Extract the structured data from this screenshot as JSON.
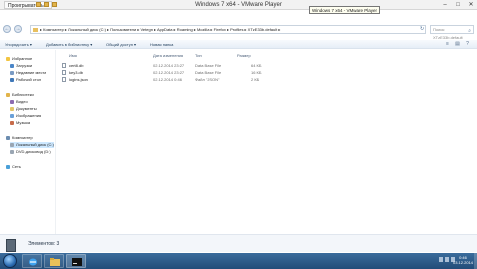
{
  "vmware": {
    "title": "Windows 7 x64 - VMware Player",
    "menu_label": "Проигрыватель ▾",
    "tooltip": "Windows 7 x64 - VMware Player",
    "controls": [
      "–",
      "□",
      "✕"
    ]
  },
  "address": {
    "back_icon": "←",
    "forward_icon": "→",
    "path": "▸ Компьютер ▸ Локальный диск (C:) ▸ Пользователи ▸ Vetegn ▸ AppData ▸ Roaming ▸ Mozilla ▸ Firefox ▸ Profiles ▸ XTzE33b.default ▸",
    "refresh_icon": "↻",
    "search_placeholder": "Поиск: XTzE33b.default",
    "search_icon": "⌕"
  },
  "toolbar": {
    "items": [
      "Упорядочить ▾",
      "Добавить в библиотеку ▾",
      "Общий доступ ▾",
      "Новая папка"
    ],
    "right_icons": [
      "≡",
      "▤",
      "?"
    ]
  },
  "sidebar": {
    "items": [
      {
        "label": "Избранное",
        "color": "#f2c542"
      },
      {
        "label": "Загрузки",
        "color": "#4a86c8"
      },
      {
        "label": "Недавние места",
        "color": "#7a9bc4"
      },
      {
        "label": "Рабочий стол",
        "color": "#3f78b8"
      },
      {
        "label": "Библиотеки",
        "color": "#e2b44a"
      },
      {
        "label": "Видео",
        "color": "#8c6bb0"
      },
      {
        "label": "Документы",
        "color": "#e2c66a"
      },
      {
        "label": "Изображения",
        "color": "#6aa0d8"
      },
      {
        "label": "Музыка",
        "color": "#c76b4a"
      },
      {
        "label": "Компьютер",
        "color": "#6c8db0"
      },
      {
        "label": "Локальный диск (C:)",
        "color": "#9aa6b3"
      },
      {
        "label": "DVD-дисковод (D:)",
        "color": "#9aa6b3"
      },
      {
        "label": "Сеть",
        "color": "#4aa0d8"
      }
    ]
  },
  "files": {
    "headers": [
      "Имя",
      "Дата изменения",
      "Тип",
      "Размер"
    ],
    "rows": [
      {
        "name": "cert8.db",
        "date": "02.12.2014 23:27",
        "type": "Data Base File",
        "size": "64 КБ"
      },
      {
        "name": "key3.db",
        "date": "02.12.2014 23:27",
        "type": "Data Base File",
        "size": "16 КБ"
      },
      {
        "name": "logins.json",
        "date": "02.12.2014 0:46",
        "type": "Файл \"JSON\"",
        "size": "2 КБ"
      }
    ]
  },
  "details": {
    "text": "Элементов: 3"
  },
  "taskbar": {
    "time": "0:46",
    "date": "03.12.2014"
  }
}
